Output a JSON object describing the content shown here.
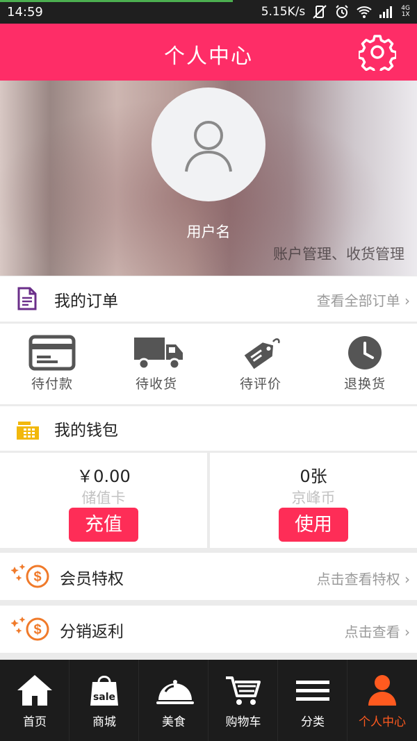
{
  "status_bar": {
    "time": "14:59",
    "speed": "5.15K/s",
    "network_top": "4G",
    "network_bottom": "1X"
  },
  "header": {
    "title": "个人中心",
    "settings_icon": "gear-icon"
  },
  "profile": {
    "username": "用户名",
    "manage_link": "账户管理、收货管理"
  },
  "orders": {
    "title": "我的订单",
    "view_all": "查看全部订单",
    "items": [
      {
        "label": "待付款",
        "icon": "card-icon"
      },
      {
        "label": "待收货",
        "icon": "truck-icon"
      },
      {
        "label": "待评价",
        "icon": "tag-icon"
      },
      {
        "label": "退换货",
        "icon": "clock-icon"
      }
    ]
  },
  "wallet": {
    "title": "我的钱包",
    "stored_value": {
      "amount": "￥0.00",
      "label": "储值卡",
      "button": "充值"
    },
    "coupon": {
      "amount": "0张",
      "label": "京峰币",
      "button": "使用"
    }
  },
  "member": {
    "title": "会员特权",
    "link": "点击查看特权"
  },
  "rebate": {
    "title": "分销返利",
    "link": "点击查看"
  },
  "tabbar": {
    "items": [
      {
        "label": "首页",
        "icon": "home-icon"
      },
      {
        "label": "商城",
        "icon": "shopping-bag-icon",
        "badge": "sale"
      },
      {
        "label": "美食",
        "icon": "food-dome-icon"
      },
      {
        "label": "购物车",
        "icon": "cart-icon"
      },
      {
        "label": "分类",
        "icon": "menu-icon"
      },
      {
        "label": "个人中心",
        "icon": "person-icon"
      }
    ],
    "active_index": 5,
    "active_color": "#ff5a1f"
  },
  "colors": {
    "brand": "#fe2d67",
    "button": "#fe2d57",
    "tabbar_bg": "#1c1c1c"
  }
}
